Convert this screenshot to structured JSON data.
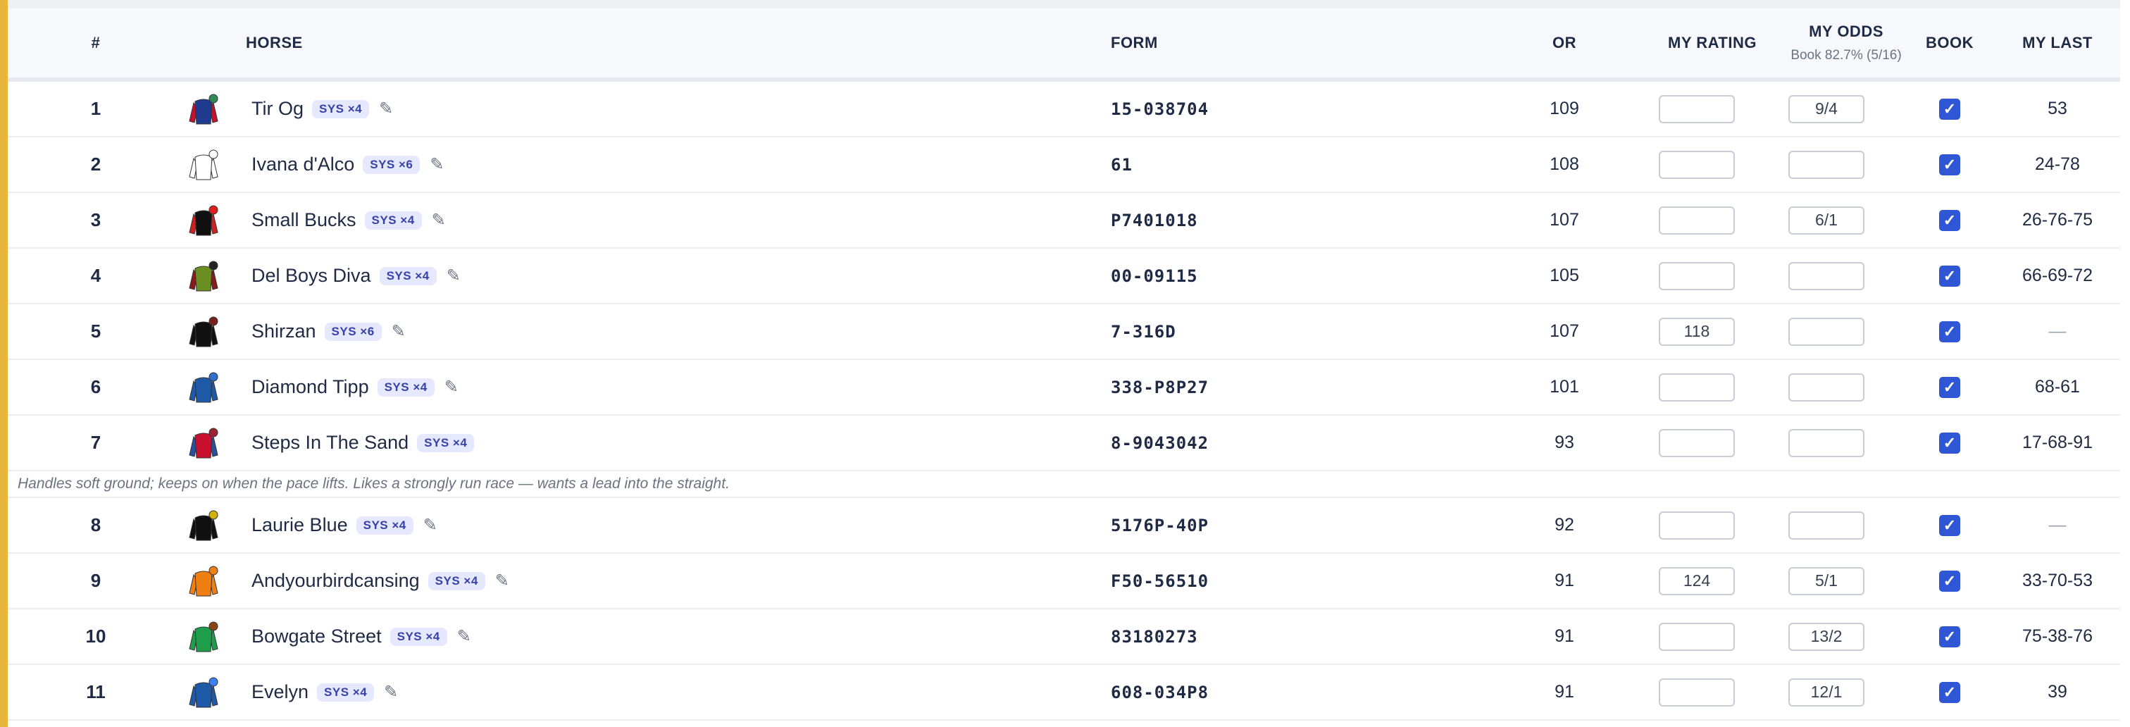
{
  "headers": {
    "num": "#",
    "horse": "HORSE",
    "form": "FORM",
    "or": "OR",
    "my_rating": "MY RATING",
    "my_odds": "MY ODDS",
    "my_odds_sub": "Book 82.7% (5/16)",
    "book": "BOOK",
    "my_last": "MY LAST"
  },
  "rows": [
    {
      "num": "1",
      "name": "Tir Og",
      "sys": "SYS ×4",
      "form": "15-038704",
      "or": "109",
      "rating": "",
      "odds": "9/4",
      "book": true,
      "last": "53",
      "silk": {
        "body": "#1f3b8f",
        "sleeve": "#c8102e",
        "cap": "#2e8b57"
      }
    },
    {
      "num": "2",
      "name": "Ivana d'Alco",
      "sys": "SYS ×6",
      "form": "61",
      "or": "108",
      "rating": "",
      "odds": "",
      "book": true,
      "last": "24-78",
      "silk": {
        "body": "#ffffff",
        "sleeve": "#ffffff",
        "cap": "#ffffff"
      }
    },
    {
      "num": "3",
      "name": "Small Bucks",
      "sys": "SYS ×4",
      "form": "P7401018",
      "or": "107",
      "rating": "",
      "odds": "6/1",
      "book": true,
      "last": "26-76-75",
      "silk": {
        "body": "#111111",
        "sleeve": "#d21f1f",
        "cap": "#e11d1d"
      }
    },
    {
      "num": "4",
      "name": "Del Boys Diva",
      "sys": "SYS ×4",
      "form": "00-09115",
      "or": "105",
      "rating": "",
      "odds": "",
      "book": true,
      "last": "66-69-72",
      "silk": {
        "body": "#6b8e23",
        "sleeve": "#8b1a1a",
        "cap": "#222222"
      }
    },
    {
      "num": "5",
      "name": "Shirzan",
      "sys": "SYS ×6",
      "form": "7-316D",
      "or": "107",
      "rating": "118",
      "odds": "",
      "book": true,
      "last": "—",
      "silk": {
        "body": "#111111",
        "sleeve": "#111111",
        "cap": "#7b1e1e"
      }
    },
    {
      "num": "6",
      "name": "Diamond Tipp",
      "sys": "SYS ×4",
      "form": "338-P8P27",
      "or": "101",
      "rating": "",
      "odds": "",
      "book": true,
      "last": "68-61",
      "silk": {
        "body": "#1e5aa8",
        "sleeve": "#1e5aa8",
        "cap": "#2f6fd0"
      }
    },
    {
      "num": "7",
      "name": "Steps In The Sand",
      "sys": "SYS ×4",
      "form": "8-9043042",
      "or": "93",
      "rating": "",
      "odds": "",
      "book": true,
      "last": "17-68-91",
      "silk": {
        "body": "#c8102e",
        "sleeve": "#2b4fa0",
        "cap": "#9b2335"
      }
    },
    {
      "num": "8",
      "name": "Laurie Blue",
      "sys": "SYS ×4",
      "form": "5176P-40P",
      "or": "92",
      "rating": "",
      "odds": "",
      "book": true,
      "last": "—",
      "silk": {
        "body": "#111111",
        "sleeve": "#111111",
        "cap": "#d4b106"
      }
    },
    {
      "num": "9",
      "name": "Andyourbirdcansing",
      "sys": "SYS ×4",
      "form": "F50-56510",
      "or": "91",
      "rating": "124",
      "odds": "5/1",
      "book": true,
      "last": "33-70-53",
      "silk": {
        "body": "#f07f13",
        "sleeve": "#f07f13",
        "cap": "#f07f13"
      }
    },
    {
      "num": "10",
      "name": "Bowgate Street",
      "sys": "SYS ×4",
      "form": "83180273",
      "or": "91",
      "rating": "",
      "odds": "13/2",
      "book": true,
      "last": "75-38-76",
      "silk": {
        "body": "#1e9e4a",
        "sleeve": "#1e9e4a",
        "cap": "#8b4513"
      }
    },
    {
      "num": "11",
      "name": "Evelyn",
      "sys": "SYS ×4",
      "form": "608-034P8",
      "or": "91",
      "rating": "",
      "odds": "12/1",
      "book": true,
      "last": "39",
      "silk": {
        "body": "#1e5aa8",
        "sleeve": "#1e5aa8",
        "cap": "#3b82f6"
      }
    }
  ],
  "note_after_row_7": "Handles soft ground; keeps on when the pace lifts. Likes a strongly run race — wants a lead into the straight.",
  "colors": {
    "accent_bar": "#e8b73a",
    "checkbox": "#2f56d4",
    "sys_badge_bg": "#e5e8ff"
  }
}
